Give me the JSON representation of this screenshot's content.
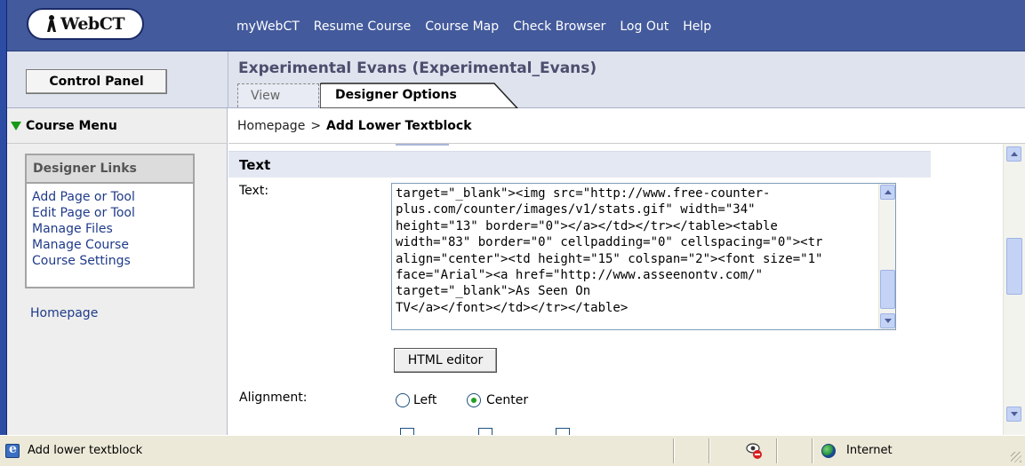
{
  "app": {
    "logo_text": "WebCT"
  },
  "topnav": {
    "items": [
      "myWebCT",
      "Resume Course",
      "Course Map",
      "Check Browser",
      "Log Out",
      "Help"
    ]
  },
  "header": {
    "control_panel_label": "Control Panel",
    "course_title": "Experimental Evans  (Experimental_Evans)",
    "tabs": [
      {
        "label": "View",
        "active": false
      },
      {
        "label": "Designer Options",
        "active": true
      }
    ]
  },
  "course_menu": {
    "label": "Course Menu"
  },
  "breadcrumb": {
    "home": "Homepage",
    "separator": ">",
    "current": "Add Lower Textblock"
  },
  "sidebar": {
    "designer_links_title": "Designer Links",
    "links": [
      "Add Page or Tool",
      "Edit Page or Tool",
      "Manage Files",
      "Manage Course",
      "Course Settings"
    ],
    "homepage_link": "Homepage"
  },
  "form": {
    "section_title": "Text",
    "text_label": "Text:",
    "text_value": "target=\"_blank\"><img src=\"http://www.free-counter-\nplus.com/counter/images/v1/stats.gif\" width=\"34\"\nheight=\"13\" border=\"0\"></a></td></tr></table><table\nwidth=\"83\" border=\"0\" cellpadding=\"0\" cellspacing=\"0\"><tr\nalign=\"center\"><td height=\"15\" colspan=\"2\"><font size=\"1\"\nface=\"Arial\"><a href=\"http://www.asseenontv.com/\"\ntarget=\"_blank\">As Seen On\nTV</a></font></td></tr></table>",
    "html_editor_label": "HTML editor",
    "alignment_label": "Alignment:",
    "alignment_options": [
      {
        "label": "Left",
        "checked": false
      },
      {
        "label": "Center",
        "checked": true
      }
    ]
  },
  "statusbar": {
    "text": "Add lower textblock",
    "zone": "Internet"
  },
  "colors": {
    "topbar": "#435a9c",
    "secondary_bar": "#dfe3ee",
    "link": "#1f3a8a",
    "menu_triangle": "#149a14"
  }
}
